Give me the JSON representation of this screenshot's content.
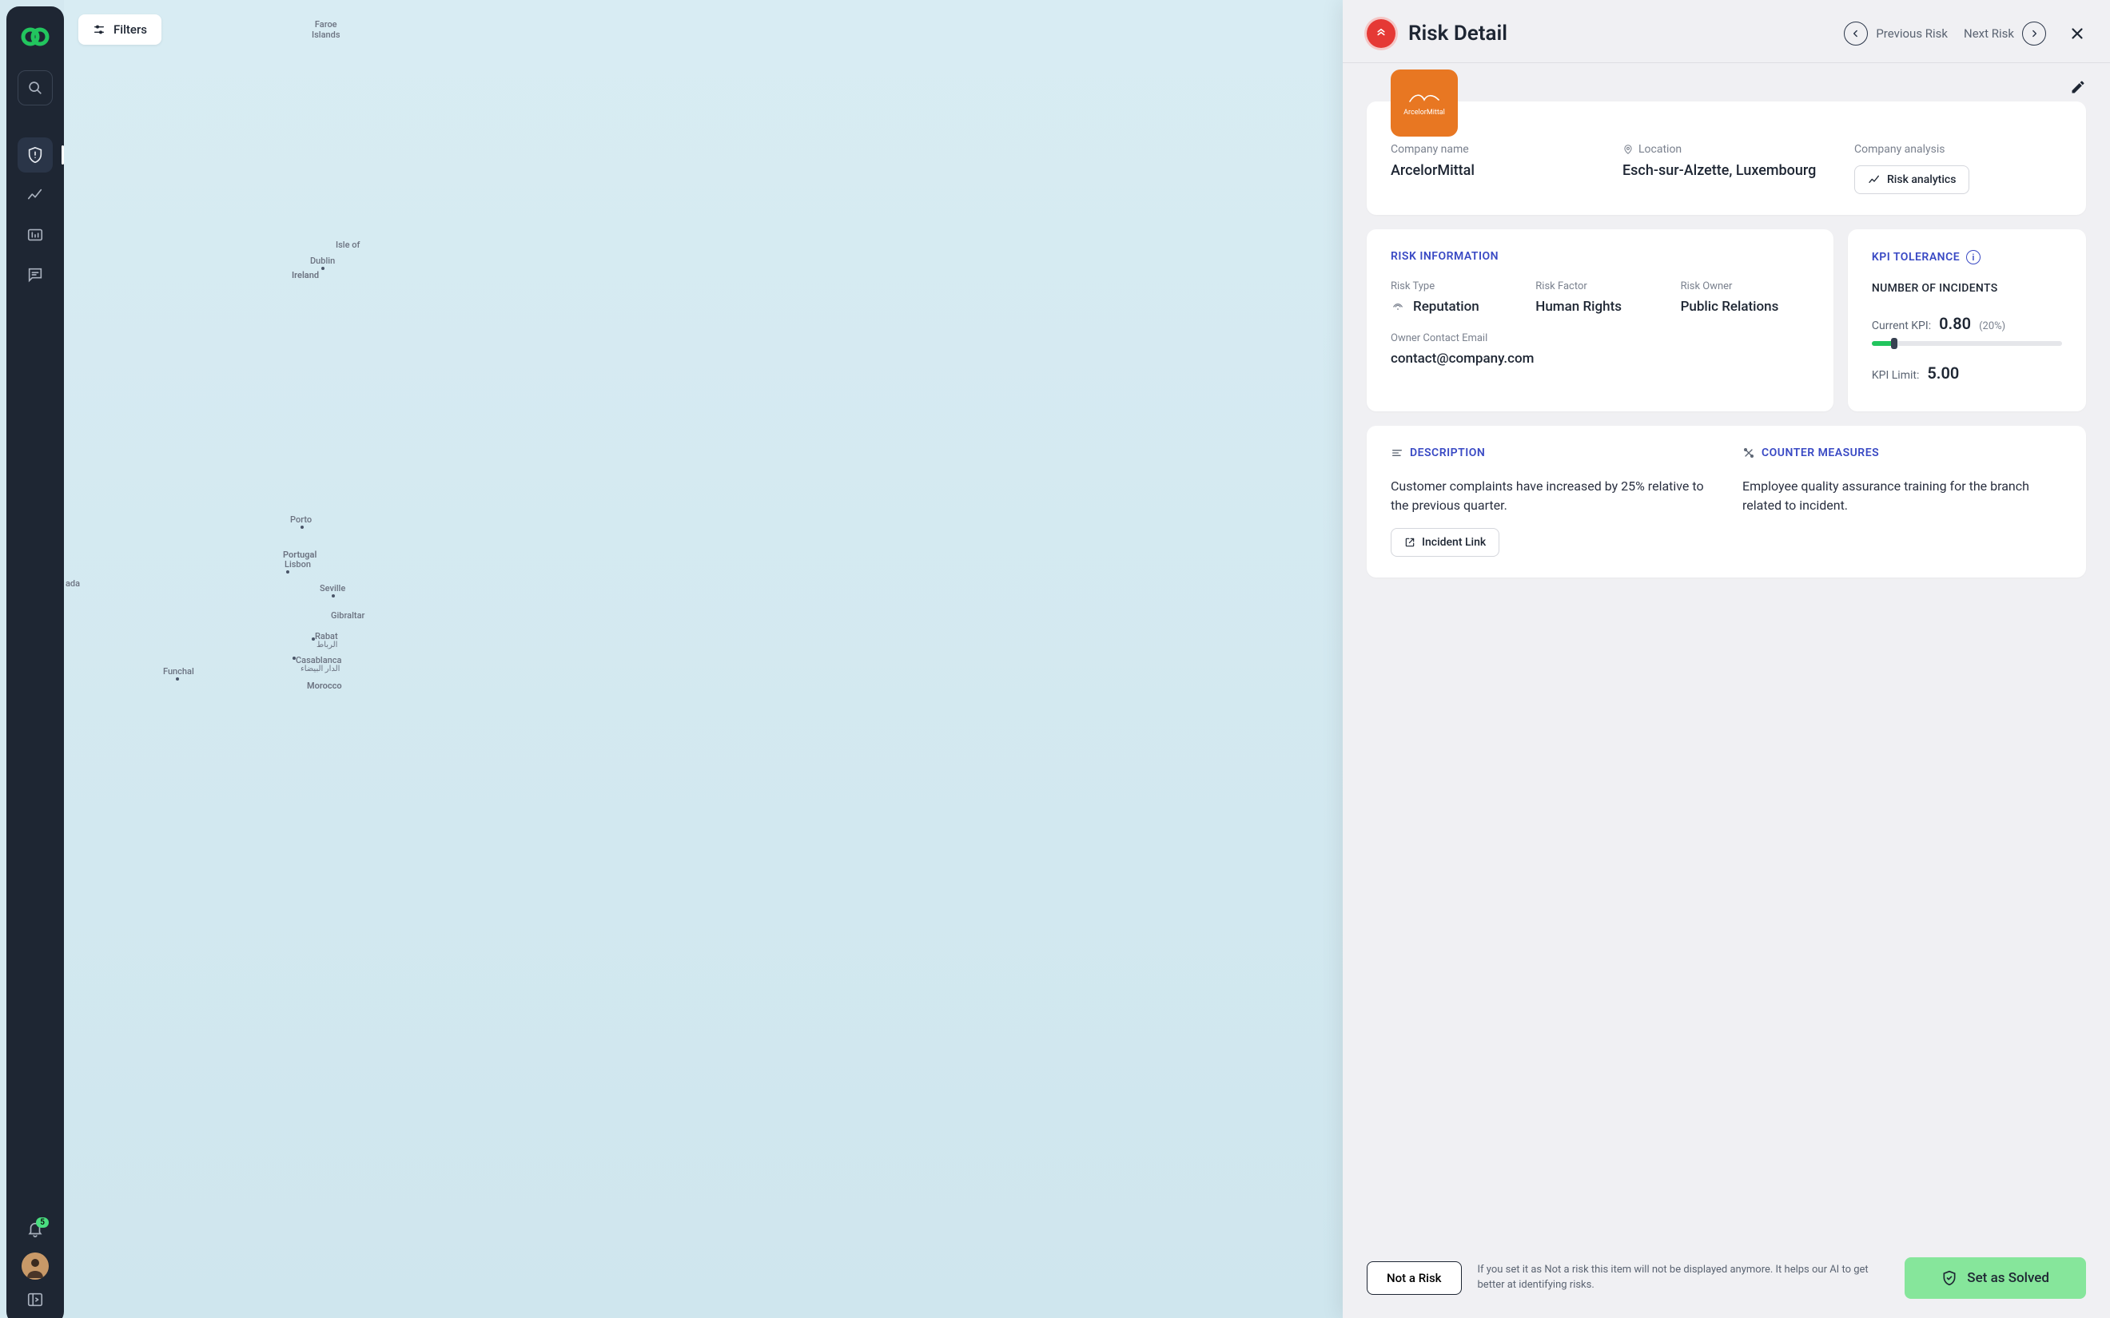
{
  "sidebar": {
    "notification_count": "5"
  },
  "filters_label": "Filters",
  "map_labels": {
    "faroe": "Faroe\nIslands",
    "isle": "Isle of",
    "dublin": "Dublin",
    "ireland": "Ireland",
    "porto": "Porto",
    "portugal": "Portugal",
    "lisbon": "Lisbon",
    "seville": "Seville",
    "gibraltar": "Gibraltar",
    "rabat": "Rabat",
    "rabat_ar": "الرباط",
    "casablanca": "Casablanca",
    "casablanca_ar": "الدار البيضاء",
    "morocco": "Morocco",
    "ada": "ada",
    "funchal": "Funchal"
  },
  "panel": {
    "title": "Risk Detail",
    "prev": "Previous Risk",
    "next": "Next Risk",
    "company_logo_text": "ArcelorMittal",
    "company_name_label": "Company name",
    "company_name": "ArcelorMittal",
    "location_label": "Location",
    "location": "Esch-sur-Alzette, Luxembourg",
    "analysis_label": "Company analysis",
    "analytics_btn": "Risk analytics",
    "risk_info_title": "RISK INFORMATION",
    "risk_type_label": "Risk Type",
    "risk_type": "Reputation",
    "risk_factor_label": "Risk Factor",
    "risk_factor": "Human Rights",
    "risk_owner_label": "Risk Owner",
    "risk_owner": "Public Relations",
    "owner_email_label": "Owner Contact Email",
    "owner_email": "contact@company.com",
    "kpi_title": "KPI TOLERANCE",
    "kpi_sub": "NUMBER OF INCIDENTS",
    "kpi_current_label": "Current KPI:",
    "kpi_current": "0.80",
    "kpi_pct": "(20%)",
    "kpi_limit_label": "KPI Limit:",
    "kpi_limit": "5.00",
    "kpi_fill_pct": 12,
    "desc_title": "DESCRIPTION",
    "desc_text": "Customer complaints have increased by 25% relative to the previous quarter.",
    "incident_btn": "Incident Link",
    "counter_title": "COUNTER MEASURES",
    "counter_text": "Employee quality assurance training for the branch related to incident.",
    "not_risk_btn": "Not a Risk",
    "footer_note": "If you set it as Not a risk this item will not be displayed anymore. It helps our AI to get better at identifying risks.",
    "solve_btn": "Set as Solved"
  }
}
